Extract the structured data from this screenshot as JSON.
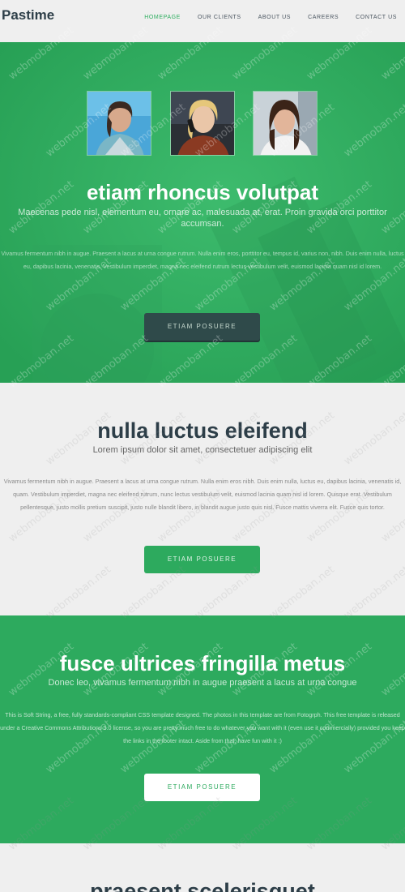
{
  "header": {
    "logo": "Pastime",
    "nav": [
      {
        "label": "HOMEPAGE",
        "active": true
      },
      {
        "label": "OUR CLIENTS",
        "active": false
      },
      {
        "label": "ABOUT US",
        "active": false
      },
      {
        "label": "CAREERS",
        "active": false
      },
      {
        "label": "CONTACT US",
        "active": false
      }
    ]
  },
  "hero": {
    "title": "etiam rhoncus volutpat",
    "subtitle": "Maecenas pede nisl, elementum eu, ornare ac, malesuada at, erat. Proin gravida orci porttitor accumsan.",
    "body": "Vivamus fermentum nibh in augue. Praesent a lacus at urna congue rutrum. Nulla enim eros, porttitor eu, tempus id, varius non, nibh. Duis enim nulla, luctus eu, dapibus lacinia, venenatis. Vestibulum imperdiet, magna nec eleifend rutrum lectus vestibulum velit, euismod lacinia quam nisl id lorem.",
    "button": "ETIAM POSUERE"
  },
  "section2": {
    "title": "nulla luctus eleifend",
    "subtitle": "Lorem ipsum dolor sit amet, consectetuer adipiscing elit",
    "body": "Vivamus fermentum nibh in augue. Praesent a lacus at urna congue rutrum. Nulla enim eros nibh. Duis enim nulla, luctus eu, dapibus lacinia, venenatis id, quam. Vestibulum imperdiet, magna nec eleifend rutrum, nunc lectus vestibulum velit, euismod lacinia quam nisl id lorem. Quisque erat. Vestibulum pellentesque, justo mollis pretium suscipit, justo nulle blandit libero, in blandit augue justo quis nisl. Fusce mattis viverra elit. Fusce quis tortor.",
    "button": "ETIAM POSUERE"
  },
  "section3": {
    "title": "fusce ultrices fringilla metus",
    "subtitle": "Donec leo, vivamus fermentum nibh in augue praesent a lacus at urna congue",
    "body": "This is Soft String, a free, fully standards-compliant CSS template designed. The photos in this template are from Fotogrph. This free template is released under a Creative Commons Attributions 3.0 license, so you are pretty much free to do whatever you want with it (even use it commercially) provided you keep the links in the footer intact. Aside from that, have fun with it :)",
    "button": "ETIAM POSUERE"
  },
  "section4": {
    "title": "praesent scelerisquet"
  },
  "watermark": "webmoban.net",
  "colors": {
    "accent": "#2daa5e",
    "dark": "#2d3e48",
    "hero_button": "#2f4a4a",
    "background": "#efefef"
  }
}
